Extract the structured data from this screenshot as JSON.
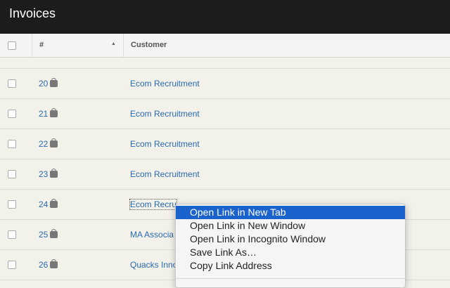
{
  "header": {
    "title": "Invoices"
  },
  "table": {
    "columns": {
      "number": "#",
      "customer": "Customer"
    },
    "rows": [
      {
        "number": "20",
        "customer": "Ecom Recruitment"
      },
      {
        "number": "21",
        "customer": "Ecom Recruitment"
      },
      {
        "number": "22",
        "customer": "Ecom Recruitment"
      },
      {
        "number": "23",
        "customer": "Ecom Recruitment"
      },
      {
        "number": "24",
        "customer": "Ecom Recru"
      },
      {
        "number": "25",
        "customer": "MA Associa"
      },
      {
        "number": "26",
        "customer": "Quacks Inno"
      }
    ]
  },
  "context_menu": {
    "items": [
      "Open Link in New Tab",
      "Open Link in New Window",
      "Open Link in Incognito Window",
      "Save Link As…",
      "Copy Link Address"
    ]
  }
}
